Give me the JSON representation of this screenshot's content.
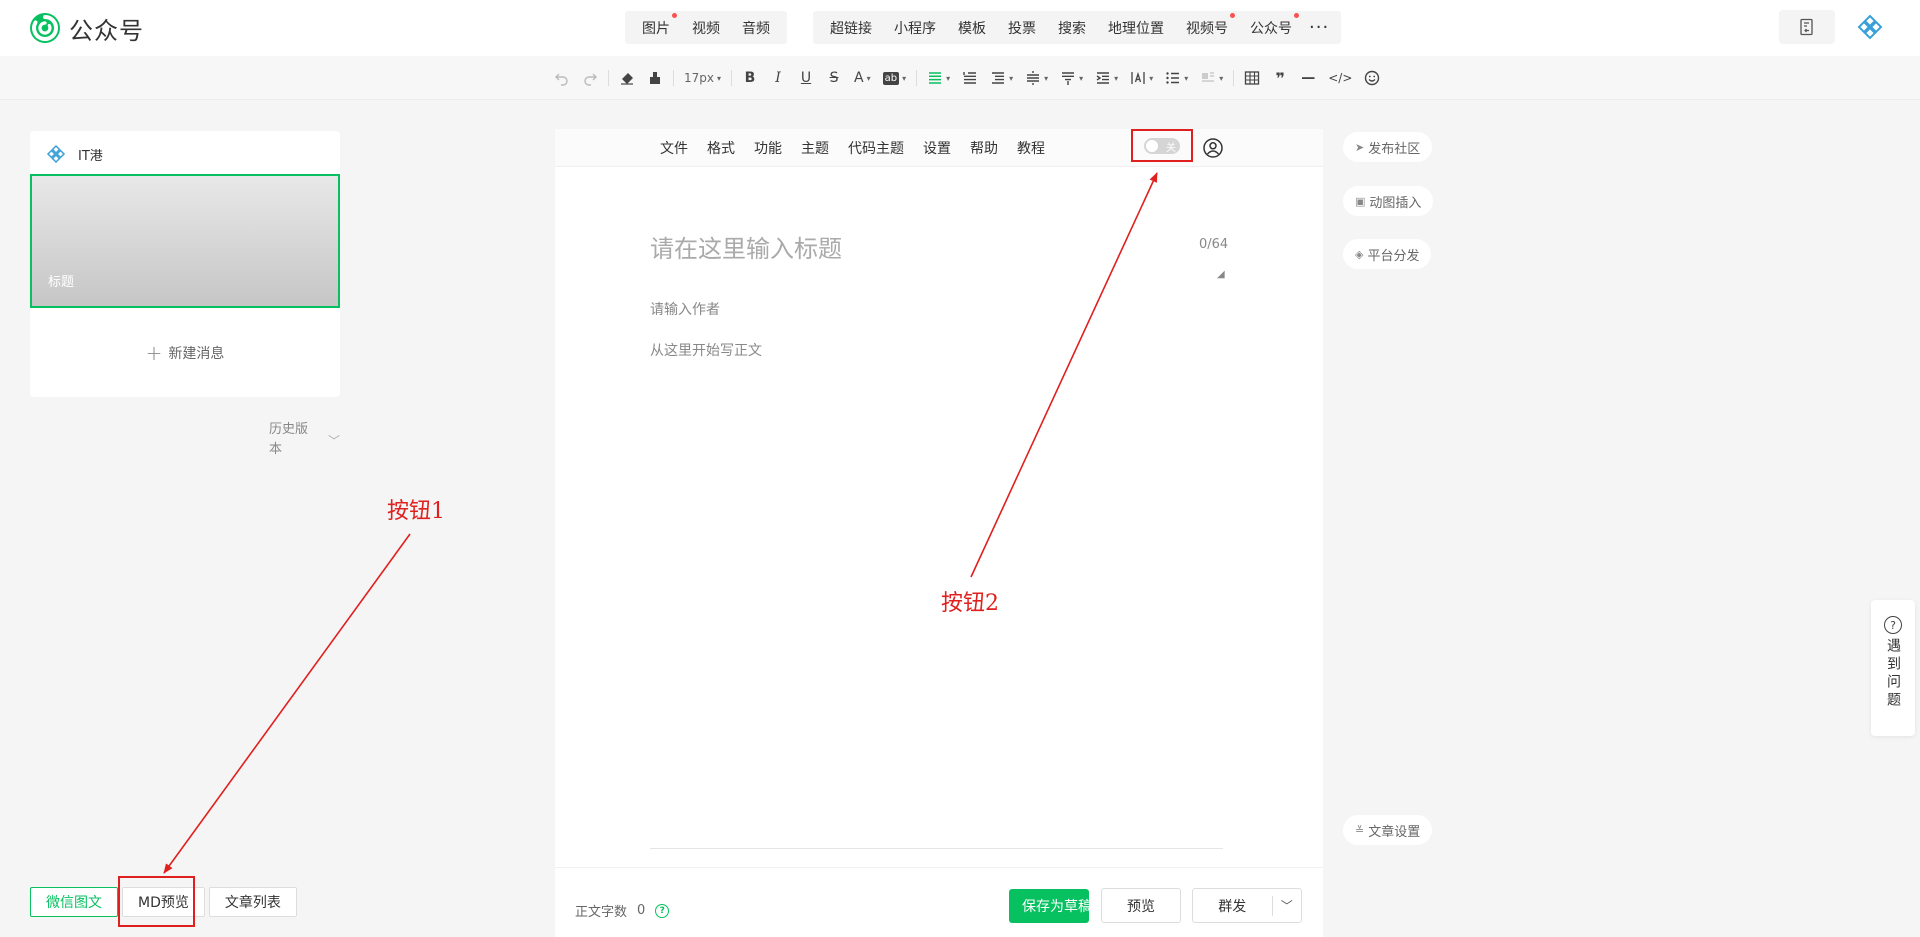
{
  "topbar": {
    "logo_text": "公众号",
    "media_items": [
      {
        "label": "图片",
        "dot": true
      },
      {
        "label": "视频",
        "dot": false
      },
      {
        "label": "音频",
        "dot": false
      }
    ],
    "insert_items": [
      {
        "label": "超链接",
        "dot": false
      },
      {
        "label": "小程序",
        "dot": false
      },
      {
        "label": "模板",
        "dot": false
      },
      {
        "label": "投票",
        "dot": false
      },
      {
        "label": "搜索",
        "dot": false
      },
      {
        "label": "地理位置",
        "dot": false
      },
      {
        "label": "视频号",
        "dot": true
      },
      {
        "label": "公众号",
        "dot": true
      }
    ],
    "more": "···"
  },
  "toolbar": {
    "font_size": "17px",
    "bold": "B",
    "italic": "I",
    "underline": "U",
    "strike": "S",
    "font_color": "A",
    "bg_color": "ab",
    "quote": "❞",
    "hr": "—",
    "code": "</>"
  },
  "left": {
    "account_name": "IT港",
    "cover_title": "标题",
    "new_message": "新建消息",
    "history": "历史版本",
    "tabs": [
      "微信图文",
      "MD预览",
      "文章列表"
    ]
  },
  "editor": {
    "menu": [
      "文件",
      "格式",
      "功能",
      "主题",
      "代码主题",
      "设置",
      "帮助",
      "教程"
    ],
    "toggle_label": "关",
    "title_placeholder": "请在这里输入标题",
    "title_count": "0/64",
    "author_placeholder": "请输入作者",
    "body_placeholder": "从这里开始写正文",
    "word_count_label": "正文字数",
    "word_count": "0",
    "save_button": "保存为草稿",
    "preview_button": "预览",
    "send_button": "群发"
  },
  "side": {
    "buttons": [
      "发布社区",
      "动图插入",
      "平台分发"
    ],
    "article_settings": "文章设置",
    "help": "遇到问题"
  },
  "annotations": {
    "label1": "按钮1",
    "label2": "按钮2",
    "color": "#e0201f"
  },
  "colors": {
    "accent": "#07c160",
    "notice_dot": "#fa5151"
  }
}
